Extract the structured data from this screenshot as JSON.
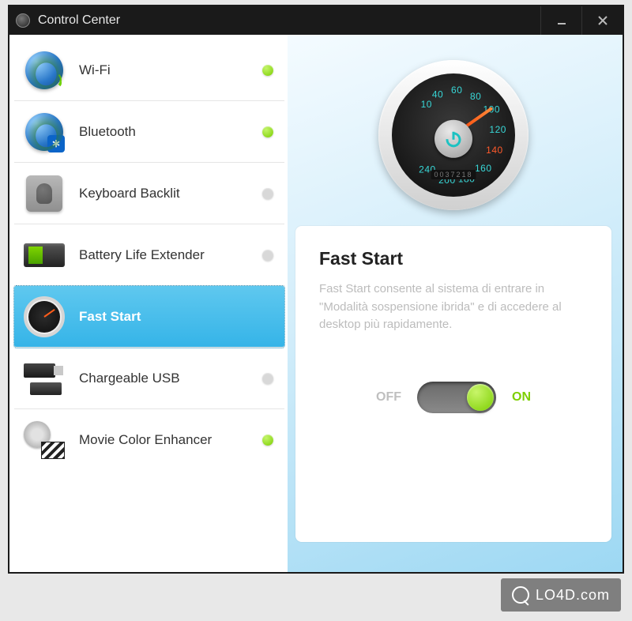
{
  "window": {
    "title": "Control Center"
  },
  "sidebar": {
    "items": [
      {
        "label": "Wi-Fi",
        "status_on": true,
        "selected": false
      },
      {
        "label": "Bluetooth",
        "status_on": true,
        "selected": false
      },
      {
        "label": "Keyboard Backlit",
        "status_on": false,
        "selected": false
      },
      {
        "label": "Battery Life Extender",
        "status_on": false,
        "selected": false
      },
      {
        "label": "Fast Start",
        "status_on": true,
        "selected": true
      },
      {
        "label": "Chargeable USB",
        "status_on": false,
        "selected": false
      },
      {
        "label": "Movie Color Enhancer",
        "status_on": true,
        "selected": false
      }
    ]
  },
  "gauge": {
    "ticks": [
      "10",
      "40",
      "60",
      "80",
      "100",
      "120",
      "140",
      "160",
      "180",
      "200",
      "240"
    ],
    "odometer": "0037218"
  },
  "detail": {
    "title": "Fast Start",
    "description": "Fast Start consente al sistema di entrare in \"Modalità sospensione ibrida\" e di accedere al desktop più rapidamente.",
    "off_label": "OFF",
    "on_label": "ON",
    "toggle_on": true
  },
  "watermark": "LO4D.com"
}
